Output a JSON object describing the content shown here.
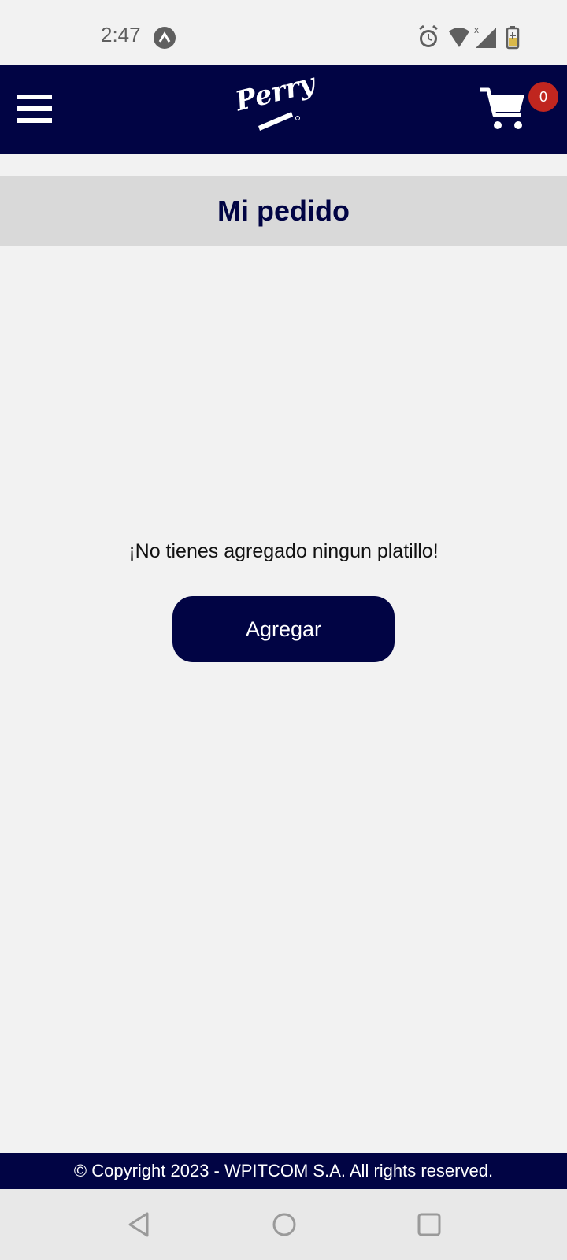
{
  "status_bar": {
    "time": "2:47",
    "icons": [
      "alarm-icon",
      "wifi-icon",
      "signal-icon",
      "battery-icon"
    ]
  },
  "header": {
    "logo_text": "Perry",
    "cart_count": "0",
    "colors": {
      "header_bg": "#010444",
      "badge_bg": "#c0261f"
    }
  },
  "title": "Mi pedido",
  "empty_state": {
    "message": "¡No tienes agregado ningun platillo!",
    "button_label": "Agregar"
  },
  "footer": {
    "text": "© Copyright 2023 - WPITCOM S.A. All rights reserved."
  },
  "nav_bar": {
    "icons": [
      "back-icon",
      "home-icon",
      "recent-apps-icon"
    ]
  }
}
